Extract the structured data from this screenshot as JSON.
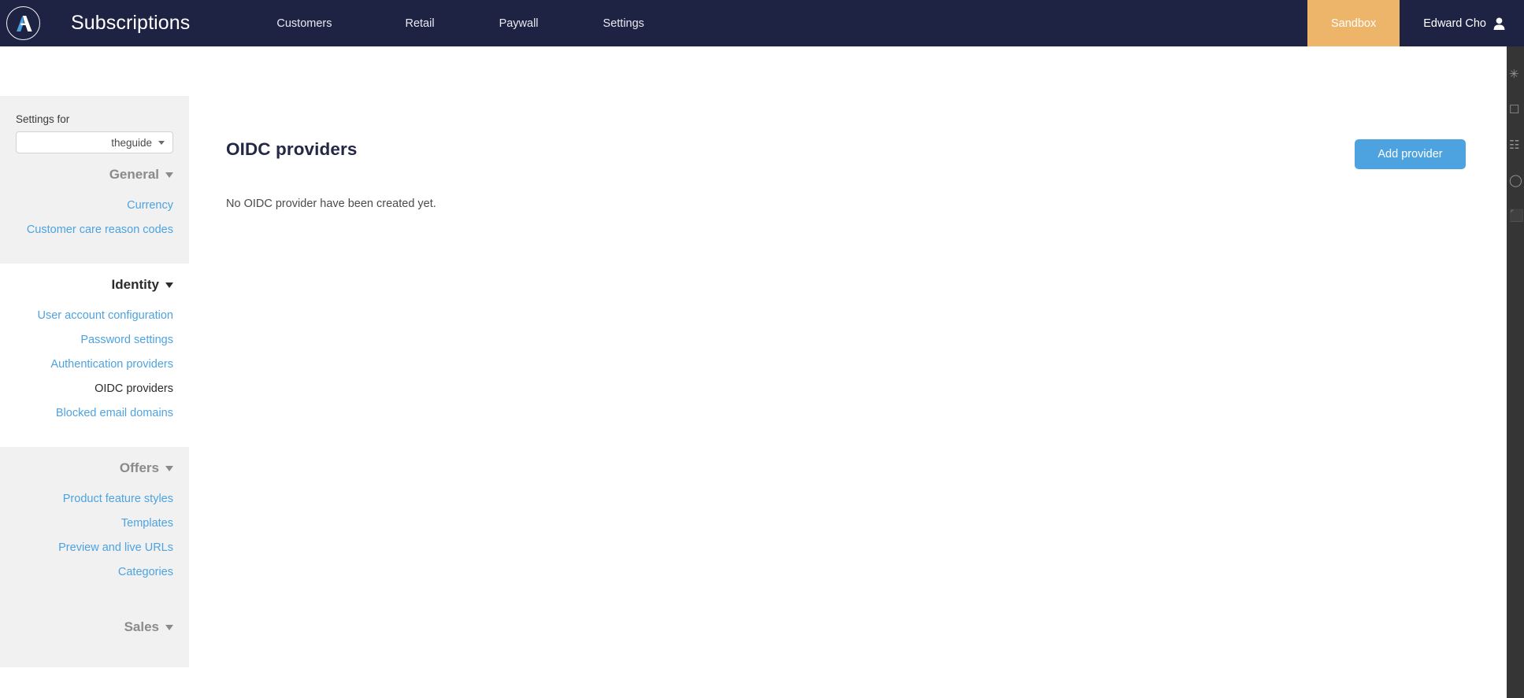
{
  "topnav": {
    "logo_icon": "aptitude-logo-icon",
    "app_title": "Subscriptions",
    "links": [
      {
        "label": "Customers"
      },
      {
        "label": "Retail"
      },
      {
        "label": "Paywall"
      },
      {
        "label": "Settings"
      }
    ],
    "env_badge": "Sandbox",
    "user_name": "Edward Cho",
    "user_icon": "user-avatar-icon",
    "colors": {
      "background": "#1e2243",
      "env_badge_bg": "#edb56a"
    }
  },
  "sidebar": {
    "settings_for_label": "Settings for",
    "scope_select": {
      "value": "theguide",
      "caret_icon": "chevron-down-icon"
    },
    "groups": [
      {
        "title": "General",
        "caret_icon": "chevron-down-icon",
        "shaded": true,
        "items": [
          {
            "label": "Currency",
            "active": false
          },
          {
            "label": "Customer care reason codes",
            "active": false
          }
        ]
      },
      {
        "title": "Identity",
        "caret_icon": "chevron-down-icon",
        "shaded": false,
        "items": [
          {
            "label": "User account configuration",
            "active": false
          },
          {
            "label": "Password settings",
            "active": false
          },
          {
            "label": "Authentication providers",
            "active": false
          },
          {
            "label": "OIDC providers",
            "active": true
          },
          {
            "label": "Blocked email domains",
            "active": false
          }
        ]
      },
      {
        "title": "Offers",
        "caret_icon": "chevron-down-icon",
        "shaded": true,
        "items": [
          {
            "label": "Product feature styles",
            "active": false
          },
          {
            "label": "Templates",
            "active": false
          },
          {
            "label": "Preview and live URLs",
            "active": false
          },
          {
            "label": "Categories",
            "active": false
          }
        ]
      },
      {
        "title": "Sales",
        "caret_icon": "chevron-down-icon",
        "shaded": true,
        "items": []
      }
    ],
    "link_color": "#4da3e0"
  },
  "main": {
    "page_title": "OIDC providers",
    "add_button_label": "Add provider",
    "empty_state_text": "No OIDC provider have been created yet.",
    "accent_color": "#4da3e0"
  },
  "ext_strip": {
    "icons": [
      "sparkle-icon",
      "square-icon",
      "book-icon",
      "circle-icon",
      "bookmark-icon"
    ],
    "glyphs": [
      "✳",
      "☐",
      "☷",
      "◯",
      "⬛"
    ]
  }
}
